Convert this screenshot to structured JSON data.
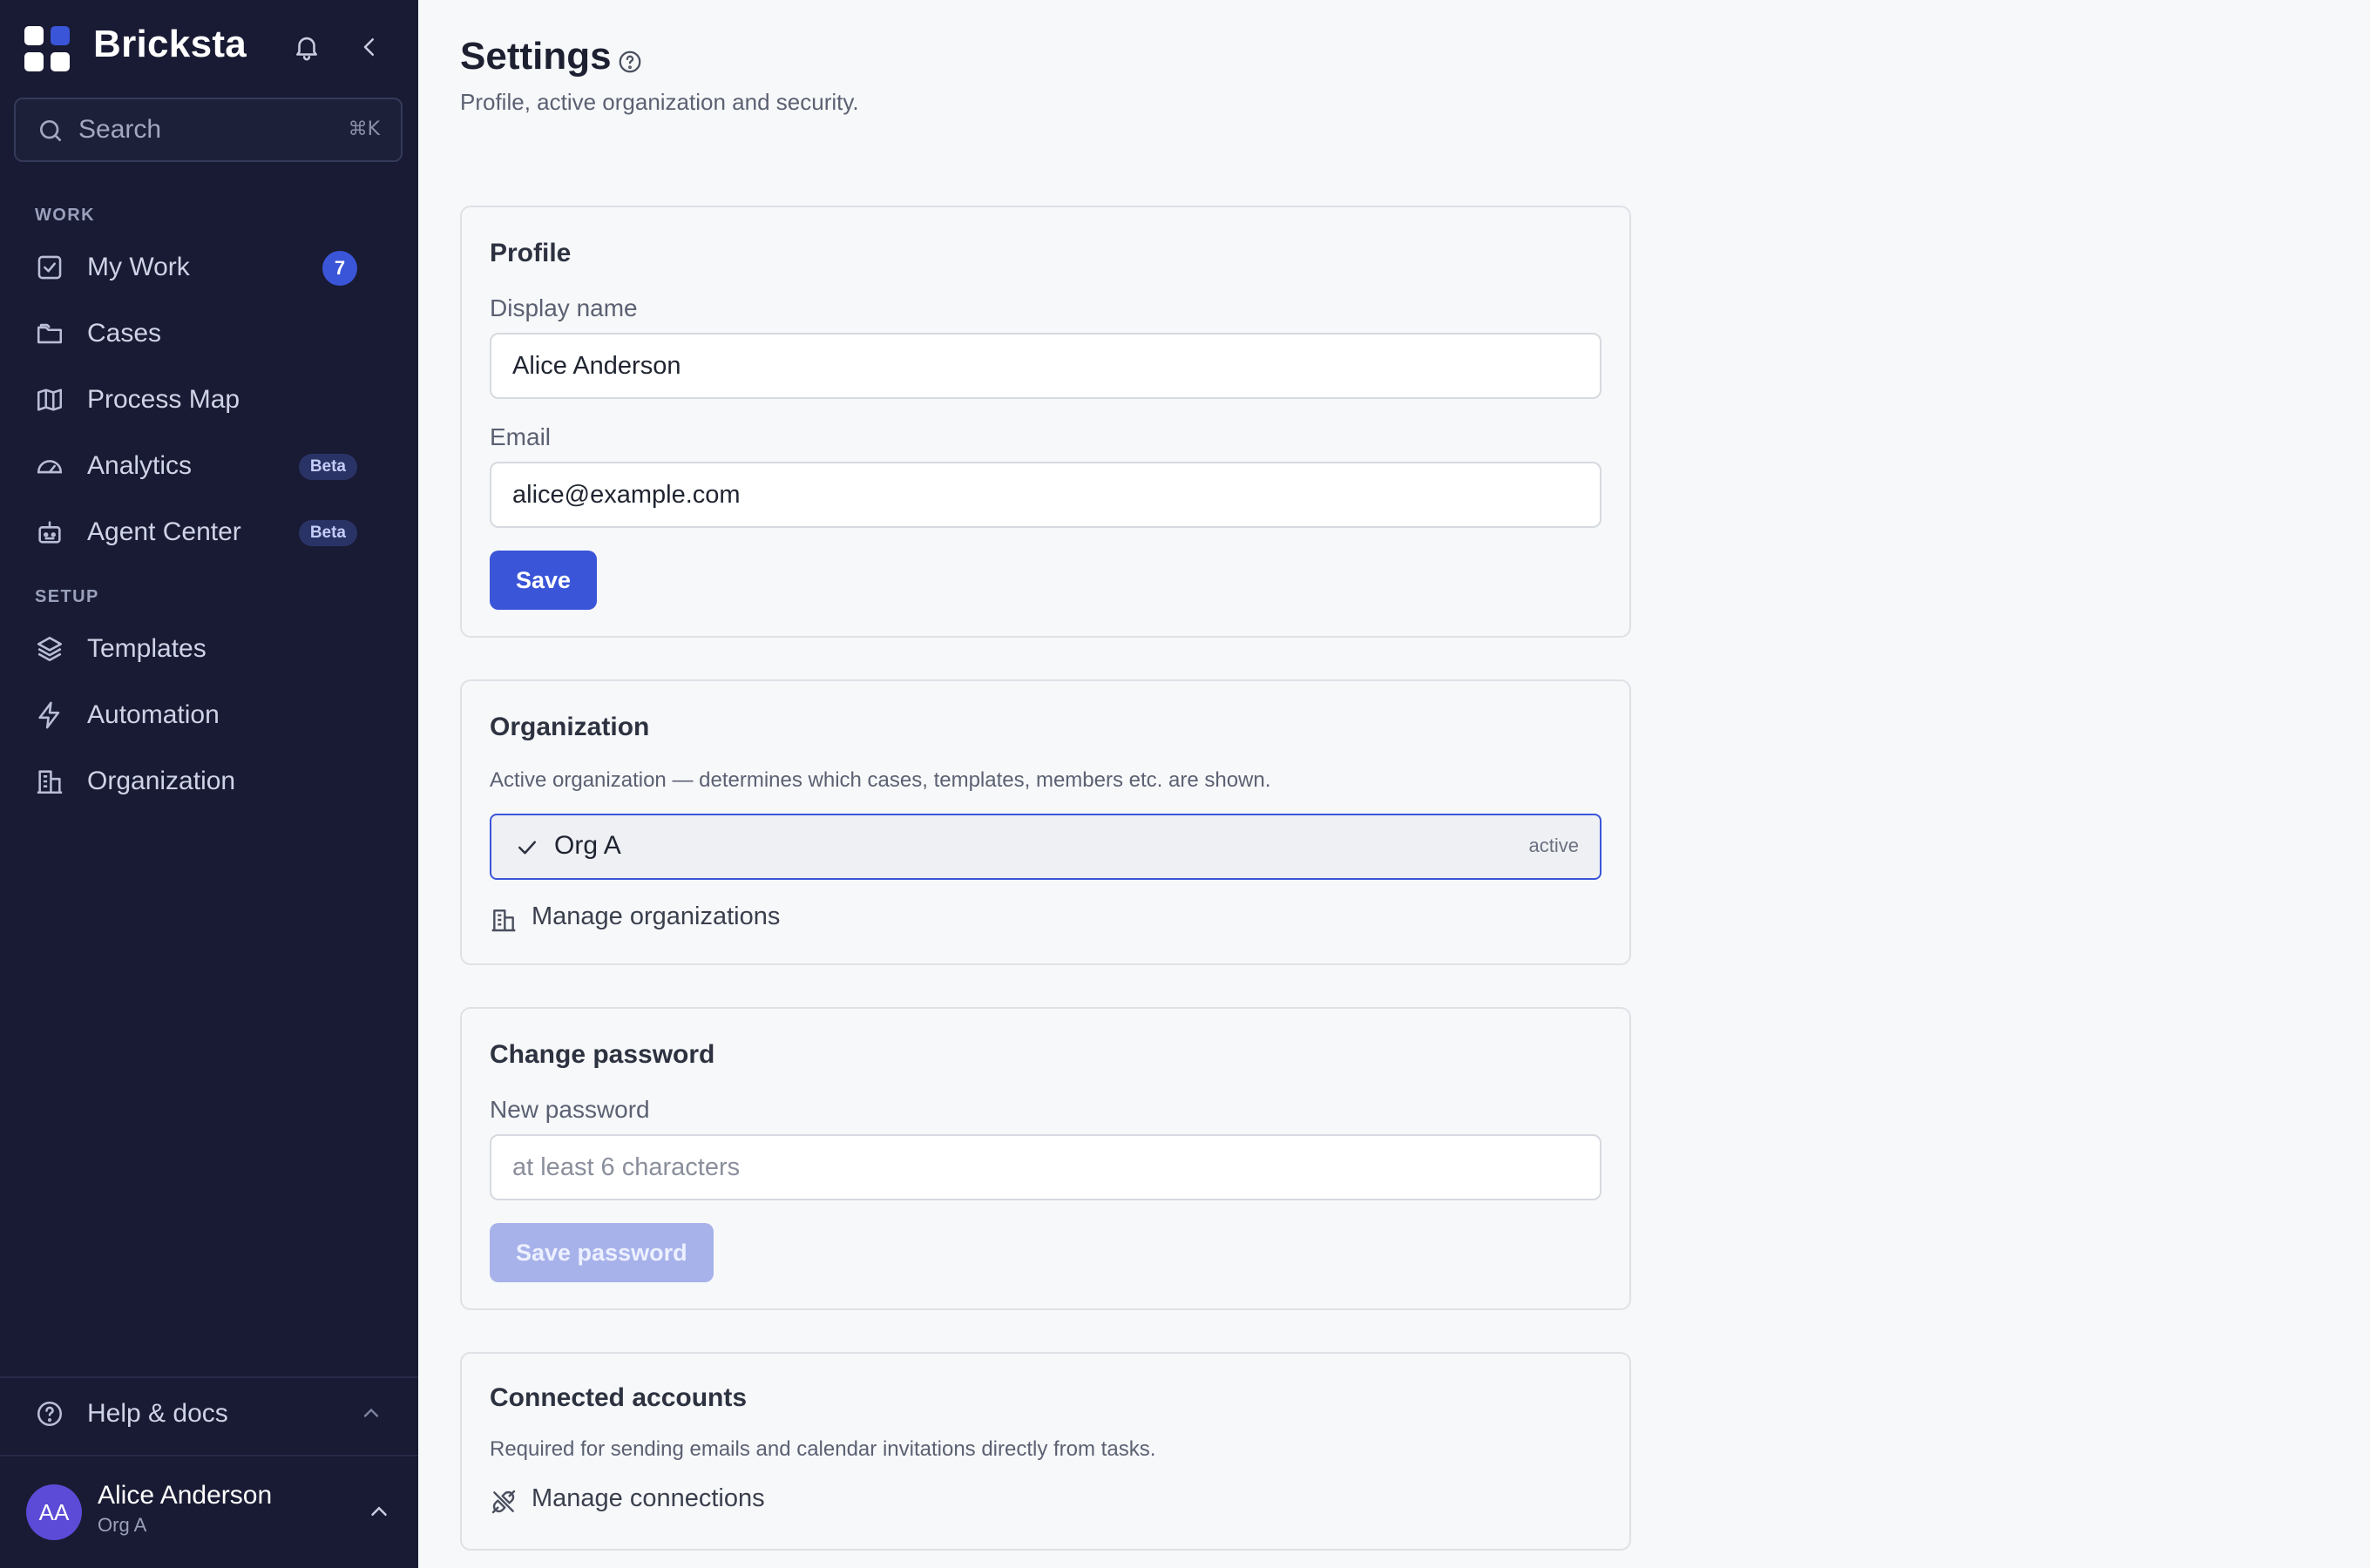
{
  "app": {
    "brand": "Bricksta"
  },
  "search": {
    "placeholder": "Search",
    "shortcut": "⌘K"
  },
  "sidebar": {
    "sections": [
      {
        "label": "WORK"
      },
      {
        "label": "SETUP"
      }
    ],
    "items": [
      {
        "label": "My Work",
        "icon": "checkbox-icon",
        "badge": "7"
      },
      {
        "label": "Cases",
        "icon": "folder-icon"
      },
      {
        "label": "Process Map",
        "icon": "map-icon"
      },
      {
        "label": "Analytics",
        "icon": "gauge-icon",
        "badge": "Beta"
      },
      {
        "label": "Agent Center",
        "icon": "bot-icon",
        "badge": "Beta"
      },
      {
        "label": "Templates",
        "icon": "layers-icon"
      },
      {
        "label": "Automation",
        "icon": "bolt-icon"
      },
      {
        "label": "Organization",
        "icon": "building-icon"
      }
    ],
    "help": {
      "label": "Help & docs"
    },
    "user": {
      "initials": "AA",
      "name": "Alice Anderson",
      "org": "Org A"
    }
  },
  "page": {
    "title": "Settings",
    "subtitle": "Profile, active organization and security."
  },
  "profile": {
    "title": "Profile",
    "display_name_label": "Display name",
    "display_name_value": "Alice Anderson",
    "email_label": "Email",
    "email_value": "alice@example.com",
    "save_label": "Save"
  },
  "organization": {
    "title": "Organization",
    "description": "Active organization — determines which cases, templates, members etc. are shown.",
    "selected": "Org A",
    "status": "active",
    "manage_label": "Manage organizations"
  },
  "password": {
    "title": "Change password",
    "new_label": "New password",
    "placeholder": "at least 6 characters",
    "save_label": "Save password"
  },
  "connected": {
    "title": "Connected accounts",
    "description": "Required for sending emails and calendar invitations directly from tasks.",
    "manage_label": "Manage connections"
  },
  "colors": {
    "sidebar_bg": "#181b33",
    "accent": "#3a55d8",
    "page_bg": "#f7f8fa"
  }
}
